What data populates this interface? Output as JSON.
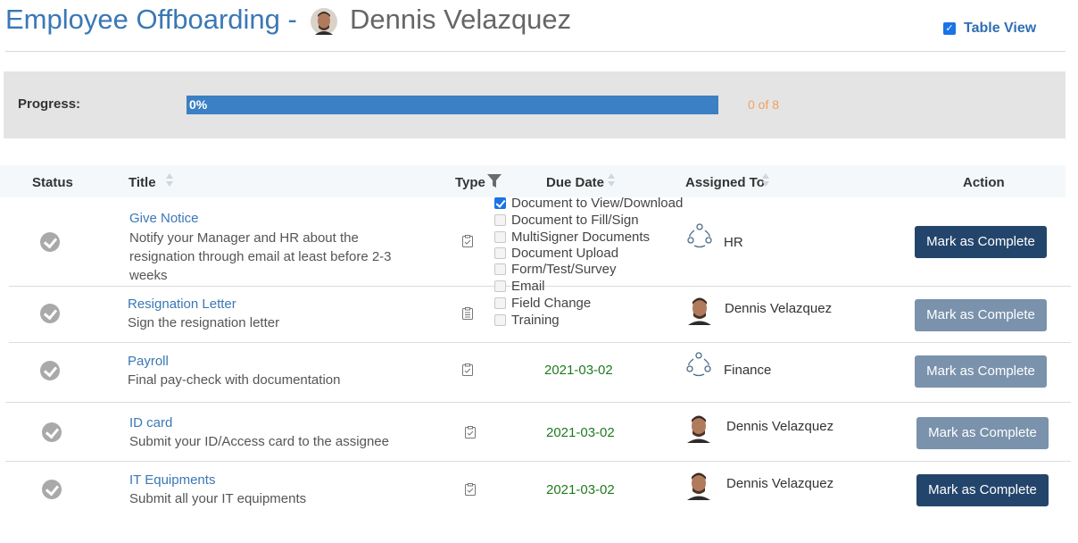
{
  "header": {
    "title_prefix": "Employee Offboarding -",
    "employee_name": "Dennis Velazquez",
    "table_view_label": "Table View",
    "table_view_checked": true
  },
  "progress": {
    "label": "Progress:",
    "percent_text": "0%",
    "fraction": 0,
    "count_text": "0 of 8",
    "bar_color": "#3b7fc4",
    "count_color": "#f0a060"
  },
  "table": {
    "columns": {
      "status": "Status",
      "title": "Title",
      "type": "Type",
      "due_date": "Due Date",
      "assigned_to": "Assigned To",
      "action": "Action"
    },
    "rows": [
      {
        "title": "Give Notice",
        "description": "Notify your Manager and HR about the resignation through email at least before 2-3 weeks",
        "type_icon": "clipboard-icon",
        "due_date": "",
        "assignee_type": "group",
        "assignee": "HR",
        "action": "Mark as Complete",
        "action_state": "active"
      },
      {
        "title": "Resignation Letter",
        "description": "Sign the resignation letter",
        "type_icon": "clipboard-list-icon",
        "due_date": "",
        "assignee_type": "person",
        "assignee": "Dennis Velazquez",
        "action": "Mark as Complete",
        "action_state": "muted"
      },
      {
        "title": "Payroll",
        "description": "Final pay-check with documentation",
        "type_icon": "clipboard-icon",
        "due_date": "2021-03-02",
        "assignee_type": "group",
        "assignee": "Finance",
        "action": "Mark as Complete",
        "action_state": "muted"
      },
      {
        "title": "ID card",
        "description": "Submit your ID/Access card to the assignee",
        "type_icon": "clipboard-icon",
        "due_date": "2021-03-02",
        "assignee_type": "person",
        "assignee": "Dennis Velazquez",
        "action": "Mark as Complete",
        "action_state": "muted"
      },
      {
        "title": "IT Equipments",
        "description": "Submit all your IT equipments",
        "type_icon": "clipboard-icon",
        "due_date": "2021-03-02",
        "assignee_type": "person",
        "assignee": "Dennis Velazquez",
        "action": "Mark as Complete",
        "action_state": "active"
      }
    ]
  },
  "type_filter": {
    "options": [
      {
        "label": "Document to View/Download",
        "checked": true
      },
      {
        "label": "Document to Fill/Sign",
        "checked": false
      },
      {
        "label": "MultiSigner Documents",
        "checked": false
      },
      {
        "label": "Document Upload",
        "checked": false
      },
      {
        "label": "Form/Test/Survey",
        "checked": false
      },
      {
        "label": "Email",
        "checked": false
      },
      {
        "label": "Field Change",
        "checked": false
      },
      {
        "label": "Training",
        "checked": false
      }
    ]
  },
  "colors": {
    "accent_blue": "#3a78b5",
    "button_active": "#24456b",
    "button_muted": "#7a92ab",
    "due_date_green": "#1f7a1f"
  }
}
